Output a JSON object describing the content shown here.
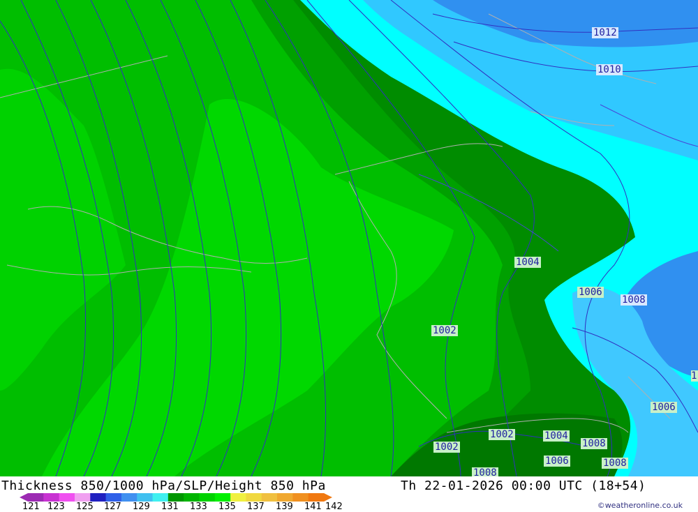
{
  "map": {
    "isobar_labels": [
      {
        "text": "1012",
        "style": "blue"
      },
      {
        "text": "1010",
        "style": "blue"
      },
      {
        "text": "1004",
        "style": "green"
      },
      {
        "text": "1006",
        "style": "green"
      },
      {
        "text": "1008",
        "style": "blue"
      },
      {
        "text": "1002",
        "style": "green"
      },
      {
        "text": "1006",
        "style": "green"
      },
      {
        "text": "1002",
        "style": "green"
      },
      {
        "text": "1004",
        "style": "green"
      },
      {
        "text": "1008",
        "style": "green"
      },
      {
        "text": "1002",
        "style": "green"
      },
      {
        "text": "1006",
        "style": "green"
      },
      {
        "text": "1008",
        "style": "green"
      },
      {
        "text": "1008",
        "style": "green"
      },
      {
        "text": "1",
        "style": "green"
      }
    ]
  },
  "footer": {
    "title": "Thickness 850/1000 hPa/SLP/Height 850 hPa",
    "datetime": "Th 22-01-2026 00:00 UTC (18+54)",
    "credit": "©weatheronline.co.uk"
  },
  "legend": {
    "ticks": [
      "121",
      "123",
      "125",
      "127",
      "129",
      "131",
      "133",
      "135",
      "137",
      "139",
      "141",
      "142"
    ],
    "colors": [
      "#9c2bb3",
      "#c832d2",
      "#f050f0",
      "#f0a0f0",
      "#2020c0",
      "#3060e8",
      "#4090f0",
      "#40c0f0",
      "#40f0f0",
      "#009600",
      "#00b400",
      "#00d200",
      "#00f000",
      "#f0f040",
      "#f0d840",
      "#f0c040",
      "#f0a830",
      "#f09020",
      "#f07810"
    ]
  }
}
